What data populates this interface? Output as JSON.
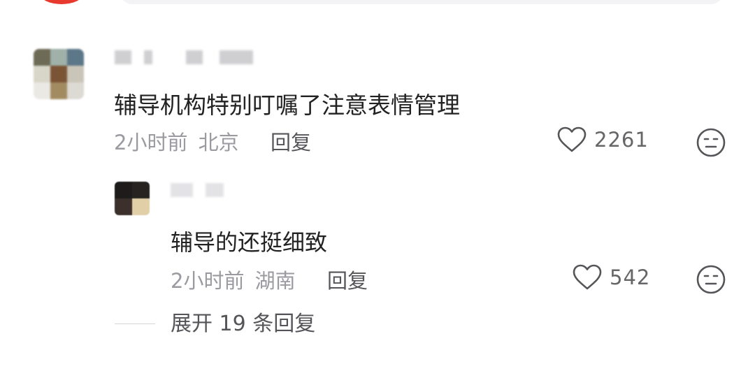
{
  "comments": [
    {
      "text": "辅导机构特别叮嘱了注意表情管理",
      "time": "2小时前",
      "location": "北京",
      "reply_label": "回复",
      "likes": "2261"
    }
  ],
  "reply": {
    "text": "辅导的还挺细致",
    "time": "2小时前",
    "location": "湖南",
    "reply_label": "回复",
    "likes": "542"
  },
  "expand_replies": {
    "label": "展开 19 条回复"
  },
  "icons": {
    "like": "heart-outline-icon",
    "dislike": "neutral-face-icon"
  },
  "colors": {
    "top_avatar": "#e8392f",
    "muted_text": "#9a9aa0"
  }
}
